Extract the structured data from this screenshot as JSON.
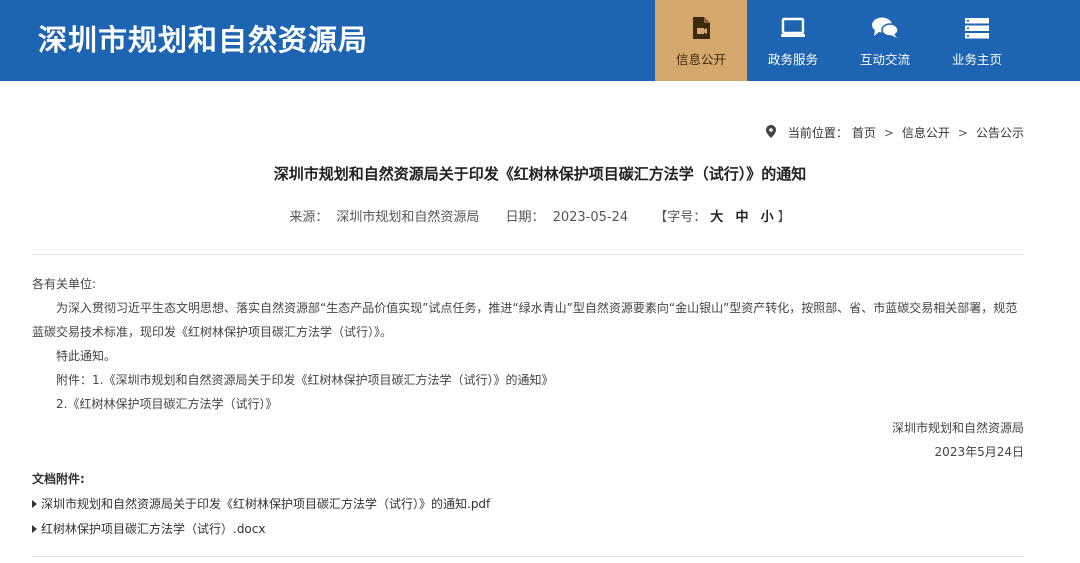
{
  "header": {
    "site_title": "深圳市规划和自然资源局",
    "nav": [
      {
        "label": "信息公开",
        "icon": "document-video-icon",
        "active": true
      },
      {
        "label": "政务服务",
        "icon": "monitor-icon",
        "active": false
      },
      {
        "label": "互动交流",
        "icon": "chat-bubbles-icon",
        "active": false
      },
      {
        "label": "业务主页",
        "icon": "server-list-icon",
        "active": false
      }
    ]
  },
  "breadcrumb": {
    "prefix": "当前位置：",
    "items": [
      "首页",
      "信息公开",
      "公告公示"
    ],
    "separator": ">"
  },
  "article": {
    "title": "深圳市规划和自然资源局关于印发《红树林保护项目碳汇方法学（试行）》的通知",
    "source_label": "来源：",
    "source": "深圳市规划和自然资源局",
    "date_label": "日期：",
    "date": "2023-05-24",
    "font_label": "【字号：",
    "font_sizes": [
      "大",
      "中",
      "小"
    ],
    "font_close": "】",
    "salutation": "各有关单位:",
    "paragraph": "为深入贯彻习近平生态文明思想、落实自然资源部“生态产品价值实现”试点任务，推进“绿水青山”型自然资源要素向“金山银山”型资产转化，按照部、省、市蓝碳交易相关部署，规范蓝碳交易技术标准，现印发《红树林保护项目碳汇方法学（试行）》。",
    "notice": "特此通知。",
    "attachment_line1": "附件：1.《深圳市规划和自然资源局关于印发《红树林保护项目碳汇方法学（试行）》的通知》",
    "attachment_line2": "2.《红树林保护项目碳汇方法学（试行）》",
    "signer": "深圳市规划和自然资源局",
    "sign_date": "2023年5月24日"
  },
  "attachments": {
    "title": "文档附件:",
    "files": [
      "深圳市规划和自然资源局关于印发《红树林保护项目碳汇方法学（试行）》的通知.pdf",
      "红树林保护项目碳汇方法学（试行）.docx"
    ]
  },
  "colors": {
    "header_bg": "#1d64b2",
    "active_nav_bg": "#d4a86a"
  }
}
